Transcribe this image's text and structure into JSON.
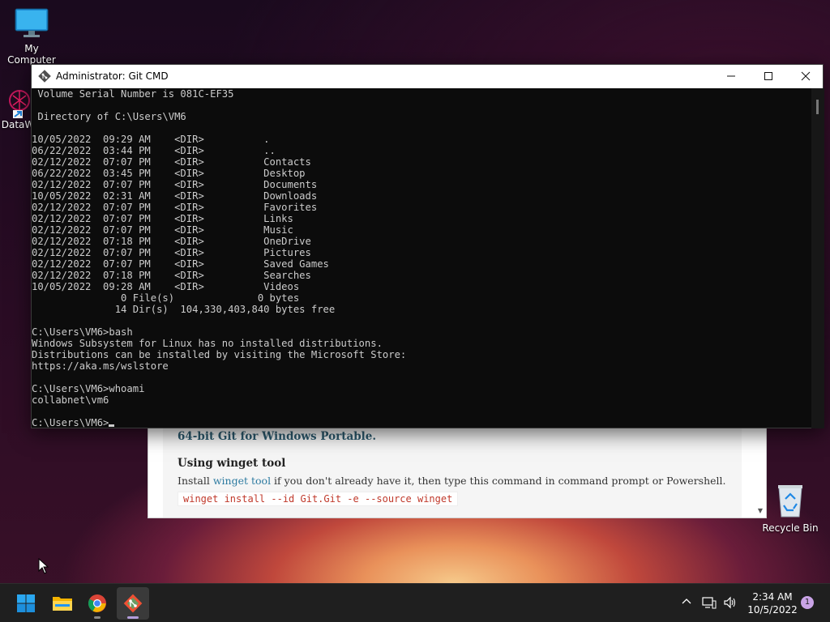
{
  "desktop": {
    "icons": [
      {
        "label": "My Computer",
        "icon": "monitor-icon"
      },
      {
        "label": "DataW",
        "icon": "datawrangler-shortcut-icon"
      },
      {
        "label": "Recycle Bin",
        "icon": "recycle-bin-icon"
      }
    ]
  },
  "console": {
    "title": "Administrator: Git CMD",
    "lines": [
      " Volume Serial Number is 081C-EF35",
      "",
      " Directory of C:\\Users\\VM6",
      "",
      "10/05/2022  09:29 AM    <DIR>          .",
      "06/22/2022  03:44 PM    <DIR>          ..",
      "02/12/2022  07:07 PM    <DIR>          Contacts",
      "06/22/2022  03:45 PM    <DIR>          Desktop",
      "02/12/2022  07:07 PM    <DIR>          Documents",
      "10/05/2022  02:31 AM    <DIR>          Downloads",
      "02/12/2022  07:07 PM    <DIR>          Favorites",
      "02/12/2022  07:07 PM    <DIR>          Links",
      "02/12/2022  07:07 PM    <DIR>          Music",
      "02/12/2022  07:18 PM    <DIR>          OneDrive",
      "02/12/2022  07:07 PM    <DIR>          Pictures",
      "02/12/2022  07:07 PM    <DIR>          Saved Games",
      "02/12/2022  07:18 PM    <DIR>          Searches",
      "10/05/2022  09:28 AM    <DIR>          Videos",
      "               0 File(s)              0 bytes",
      "              14 Dir(s)  104,330,403,840 bytes free",
      "",
      "C:\\Users\\VM6>bash",
      "Windows Subsystem for Linux has no installed distributions.",
      "Distributions can be installed by visiting the Microsoft Store:",
      "https://aka.ms/wslstore",
      "",
      "C:\\Users\\VM6>whoami",
      "collabnet\\vm6",
      ""
    ],
    "prompt": "C:\\Users\\VM6>"
  },
  "browser_page": {
    "link_heading": "64-bit Git for Windows Portable.",
    "section_heading": "Using winget tool",
    "paragraph_prefix": "Install ",
    "paragraph_link": "winget tool",
    "paragraph_suffix": " if you don't already have it, then type this command in command prompt or Powershell.",
    "code": "winget install --id Git.Git -e --source winget"
  },
  "taskbar": {
    "apps": [
      {
        "name": "start",
        "icon": "windows-logo-icon"
      },
      {
        "name": "file-explorer",
        "icon": "folder-icon"
      },
      {
        "name": "chrome",
        "icon": "chrome-icon"
      },
      {
        "name": "git-cmd",
        "icon": "git-icon",
        "active": true
      }
    ],
    "time": "2:34 AM",
    "date": "10/5/2022",
    "notification_count": "1"
  },
  "colors": {
    "terminal_bg": "#0c0c0c",
    "terminal_fg": "#cccccc",
    "taskbar_bg": "#1f1f1f",
    "git_accent": "#f05033"
  }
}
